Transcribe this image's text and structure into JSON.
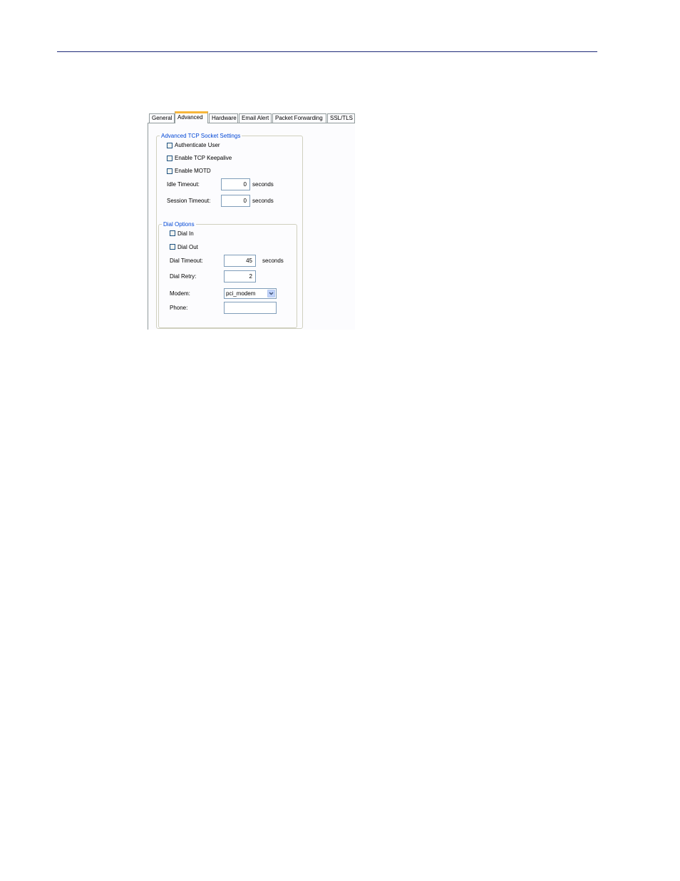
{
  "tabs": [
    {
      "label": "General",
      "active": false
    },
    {
      "label": "Advanced",
      "active": true
    },
    {
      "label": "Hardware",
      "active": false
    },
    {
      "label": "Email Alert",
      "active": false
    },
    {
      "label": "Packet Forwarding",
      "active": false
    },
    {
      "label": "SSL/TLS",
      "active": false
    }
  ],
  "tcp_settings": {
    "title": "Advanced TCP Socket Settings",
    "authenticate_user": {
      "label": "Authenticate User",
      "checked": false
    },
    "enable_keepalive": {
      "label": "Enable TCP Keepalive",
      "checked": false
    },
    "enable_motd": {
      "label": "Enable MOTD",
      "checked": false
    },
    "idle_timeout": {
      "label": "Idle Timeout:",
      "value": "0",
      "unit": "seconds"
    },
    "session_timeout": {
      "label": "Session Timeout:",
      "value": "0",
      "unit": "seconds"
    }
  },
  "dial_options": {
    "title": "Dial Options",
    "dial_in": {
      "label": "Dial In",
      "checked": false
    },
    "dial_out": {
      "label": "Dial Out",
      "checked": false
    },
    "dial_timeout": {
      "label": "Dial Timeout:",
      "value": "45",
      "unit": "seconds"
    },
    "dial_retry": {
      "label": "Dial Retry:",
      "value": "2"
    },
    "modem": {
      "label": "Modem:",
      "value": "pci_modem"
    },
    "phone": {
      "label": "Phone:",
      "value": ""
    }
  },
  "icons": {
    "dropdown": "chevron-down-icon"
  },
  "colors": {
    "rule": "#1e2a78",
    "active_tab_accent": "#f7b63a",
    "group_title": "#0046d5"
  }
}
